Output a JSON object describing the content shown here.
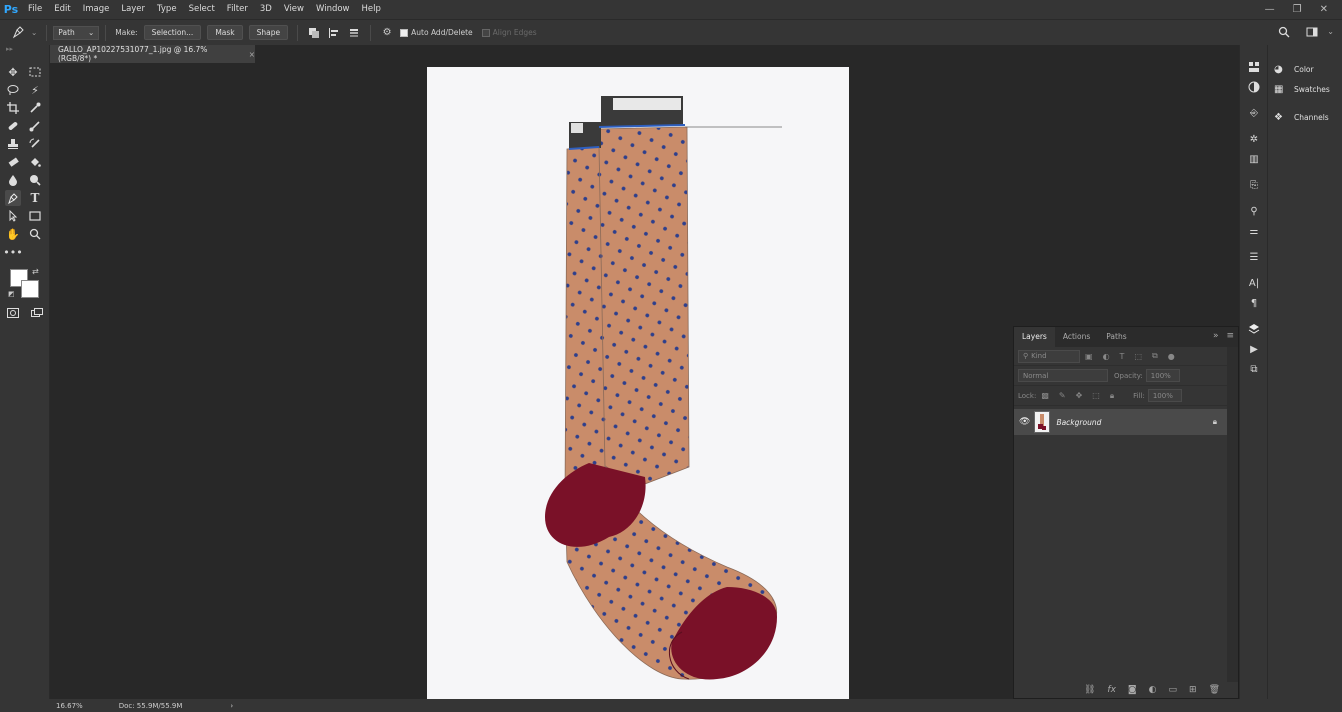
{
  "app": {
    "logo": "Ps",
    "menu": [
      "File",
      "Edit",
      "Image",
      "Layer",
      "Type",
      "Select",
      "Filter",
      "3D",
      "View",
      "Window",
      "Help"
    ],
    "window_controls": [
      "—",
      "❐",
      "✕"
    ]
  },
  "options_bar": {
    "tool_mode": "Path",
    "make_label": "Make:",
    "selection_button": "Selection...",
    "mask_button": "Mask",
    "shape_button": "Shape",
    "auto_add_delete_label": "Auto Add/Delete",
    "auto_add_delete_checked": true,
    "align_edges_label": "Align Edges",
    "align_edges_checked": false
  },
  "document_tab": {
    "title": "GALLO_AP10227531077_1.jpg @ 16.7% (RGB/8*) *",
    "close": "×"
  },
  "status": {
    "zoom": "16.67%",
    "doc_size": "Doc: 55.9M/55.9M",
    "arrow": "›"
  },
  "right_panel": {
    "items": [
      {
        "label": "Color",
        "icon": "color-wheel-icon"
      },
      {
        "label": "Swatches",
        "icon": "grid-icon"
      },
      {
        "label": "Channels",
        "icon": "channels-icon"
      }
    ]
  },
  "layers_panel": {
    "tabs": [
      "Layers",
      "Actions",
      "Paths"
    ],
    "active_tab": "Layers",
    "kind_placeholder": "Kind",
    "blend_mode": "Normal",
    "opacity_label": "Opacity:",
    "opacity_value": "100%",
    "lock_label": "Lock:",
    "fill_label": "Fill:",
    "fill_value": "100%",
    "layers": [
      {
        "name": "Background",
        "visible": true,
        "locked": true
      }
    ]
  },
  "colors": {
    "ps_blue": "#31a8ff",
    "sock_tan": "#c98c6a",
    "sock_maroon": "#7a1128",
    "dot_blue": "#2e3f8c"
  }
}
